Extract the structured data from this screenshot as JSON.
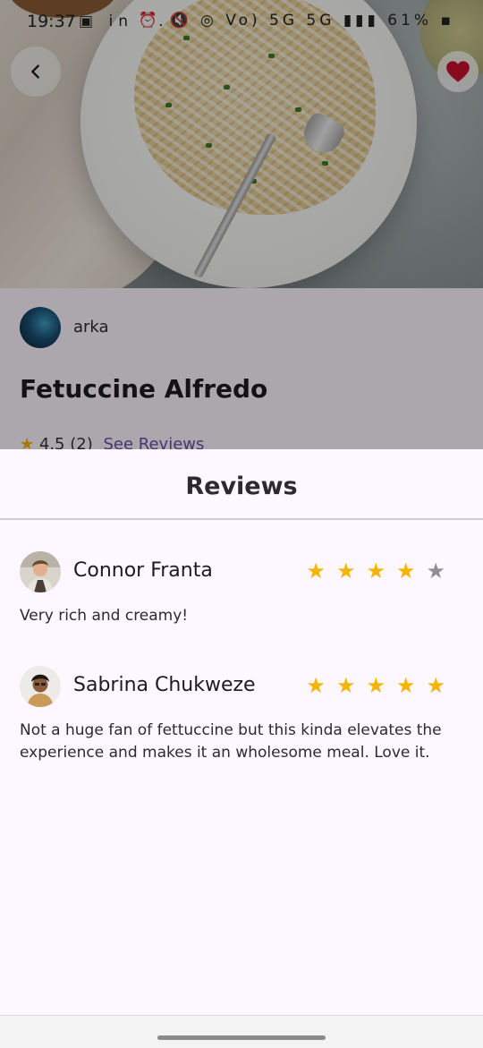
{
  "status_bar": {
    "time": "19:37",
    "left_icons": "▣ in 7. •",
    "right_icons": "⏰ 🔇 ◎ Vo) 5G 5G ▮▮▮ 61% ▪"
  },
  "recipe": {
    "author": "arka",
    "title": "Fetuccine Alfredo",
    "rating": "4.5",
    "review_count": "(2)",
    "see_reviews_label": "See Reviews"
  },
  "reviews_sheet": {
    "title": "Reviews",
    "items": [
      {
        "name": "Connor Franta",
        "rating": 4,
        "text": "Very rich and creamy!"
      },
      {
        "name": "Sabrina Chukweze",
        "rating": 5,
        "text": "Not a huge fan of fettuccine but this kinda elevates the experience and makes it an wholesome meal. Love it."
      }
    ]
  },
  "colors": {
    "star_filled": "#f5b400",
    "star_empty": "#8e8e93",
    "link": "#6750a4",
    "favorite": "#c8102e",
    "sheet_bg": "#fdf7ff"
  },
  "icons": {
    "back": "chevron-left-icon",
    "favorite": "heart-icon",
    "star": "star-icon"
  }
}
